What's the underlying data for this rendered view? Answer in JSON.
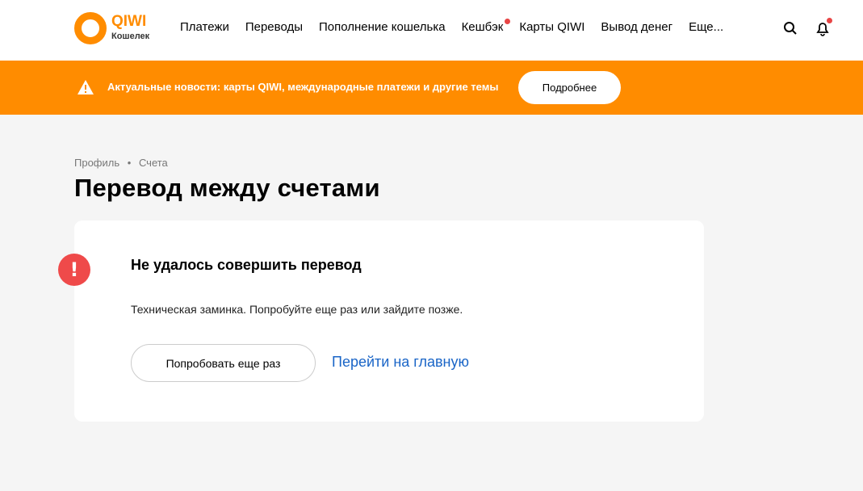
{
  "header": {
    "logo_title": "QIWI",
    "logo_subtitle": "Кошелек",
    "nav": [
      "Платежи",
      "Переводы",
      "Пополнение кошелька",
      "Кешбэк",
      "Карты QIWI",
      "Вывод денег",
      "Еще..."
    ]
  },
  "banner": {
    "text": "Актуальные новости: карты QIWI, международные платежи и другие темы",
    "button": "Подробнее"
  },
  "breadcrumb": {
    "items": [
      "Профиль",
      "Счета"
    ],
    "separator": "•"
  },
  "page_title": "Перевод между счетами",
  "error": {
    "title": "Не удалось совершить перевод",
    "message": "Техническая заминка. Попробуйте еще раз или зайдите позже.",
    "retry": "Попробовать еще раз",
    "home_link": "Перейти на главную"
  },
  "colors": {
    "brand": "#ff8c00",
    "error": "#ef4a4a",
    "link": "#1a65c7"
  }
}
